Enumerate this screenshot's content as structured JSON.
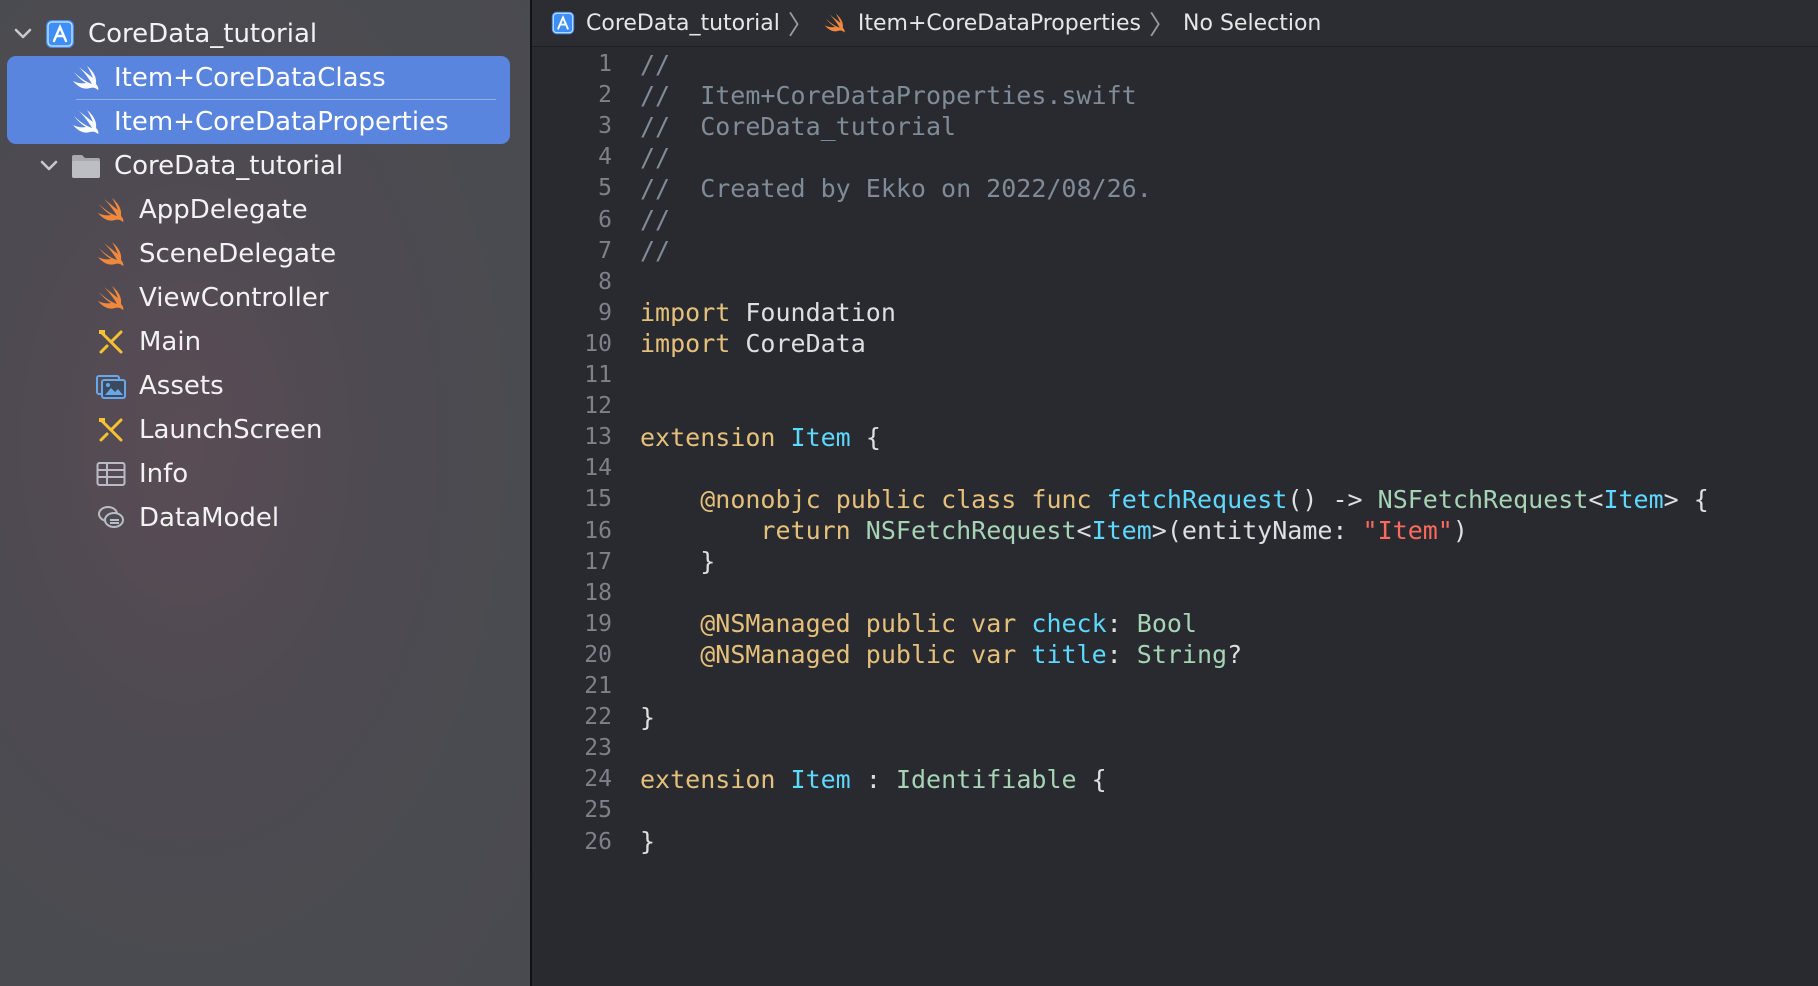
{
  "sidebar": {
    "items": [
      {
        "label": "CoreData_tutorial",
        "icon": "xcode-project-icon",
        "level": 0,
        "disclosure": "expanded",
        "selected": false
      },
      {
        "label": "Item+CoreDataClass",
        "icon": "swift-file-icon",
        "level": 1,
        "selected": true
      },
      {
        "label": "Item+CoreDataProperties",
        "icon": "swift-file-icon",
        "level": 1,
        "selected": true
      },
      {
        "label": "CoreData_tutorial",
        "icon": "folder-icon",
        "level": 1,
        "disclosure": "expanded",
        "selected": false
      },
      {
        "label": "AppDelegate",
        "icon": "swift-file-icon",
        "level": 2,
        "selected": false
      },
      {
        "label": "SceneDelegate",
        "icon": "swift-file-icon",
        "level": 2,
        "selected": false
      },
      {
        "label": "ViewController",
        "icon": "swift-file-icon",
        "level": 2,
        "selected": false
      },
      {
        "label": "Main",
        "icon": "storyboard-icon",
        "level": 2,
        "selected": false
      },
      {
        "label": "Assets",
        "icon": "asset-catalog-icon",
        "level": 2,
        "selected": false
      },
      {
        "label": "LaunchScreen",
        "icon": "storyboard-icon",
        "level": 2,
        "selected": false
      },
      {
        "label": "Info",
        "icon": "plist-icon",
        "level": 2,
        "selected": false
      },
      {
        "label": "DataModel",
        "icon": "coredata-model-icon",
        "level": 2,
        "selected": false
      }
    ]
  },
  "jumpbar": {
    "project": "CoreData_tutorial",
    "file": "Item+CoreDataProperties",
    "selection": "No Selection",
    "separator": "〉"
  },
  "editor": {
    "lines": [
      {
        "n": "1",
        "code": "//"
      },
      {
        "n": "2",
        "code": "//  Item+CoreDataProperties.swift"
      },
      {
        "n": "3",
        "code": "//  CoreData_tutorial"
      },
      {
        "n": "4",
        "code": "//"
      },
      {
        "n": "5",
        "code": "//  Created by Ekko on 2022/08/26."
      },
      {
        "n": "6",
        "code": "//"
      },
      {
        "n": "7",
        "code": "//"
      },
      {
        "n": "8",
        "code": ""
      },
      {
        "n": "9",
        "code": "import Foundation"
      },
      {
        "n": "10",
        "code": "import CoreData"
      },
      {
        "n": "11",
        "code": ""
      },
      {
        "n": "12",
        "code": ""
      },
      {
        "n": "13",
        "code": "extension Item {"
      },
      {
        "n": "14",
        "code": ""
      },
      {
        "n": "15",
        "code": "    @nonobjc public class func fetchRequest() -> NSFetchRequest<Item> {"
      },
      {
        "n": "16",
        "code": "        return NSFetchRequest<Item>(entityName: \"Item\")"
      },
      {
        "n": "17",
        "code": "    }"
      },
      {
        "n": "18",
        "code": ""
      },
      {
        "n": "19",
        "code": "    @NSManaged public var check: Bool"
      },
      {
        "n": "20",
        "code": "    @NSManaged public var title: String?"
      },
      {
        "n": "21",
        "code": ""
      },
      {
        "n": "22",
        "code": "}"
      },
      {
        "n": "23",
        "code": ""
      },
      {
        "n": "24",
        "code": "extension Item : Identifiable {"
      },
      {
        "n": "25",
        "code": ""
      },
      {
        "n": "26",
        "code": "}"
      }
    ]
  },
  "colors": {
    "selection": "#5a85de",
    "swift_icon": "#f0883e",
    "xcode_icon": "#3f8ef6",
    "comment": "#7f8c98",
    "keyword": "#e5c07b",
    "type": "#5dd8ff",
    "string": "#fc6a5d"
  }
}
